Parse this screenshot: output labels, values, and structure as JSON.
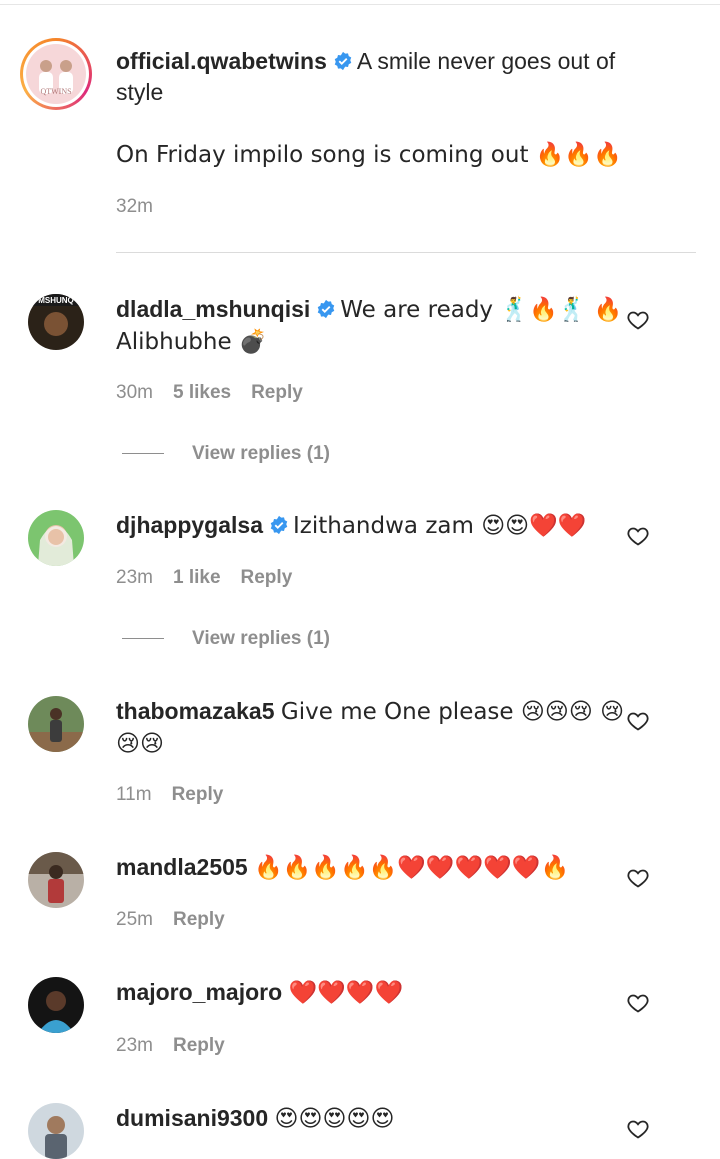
{
  "caption": {
    "username": "official.qwabetwins",
    "avatar_text": "QTWINS",
    "text": "A smile never goes out of style",
    "text2": "On Friday impilo song is coming out 🔥🔥🔥",
    "time": "32m"
  },
  "comments": [
    {
      "username": "dladla_mshunqisi",
      "avatar_text": "MSHUNQ",
      "text": "We are ready 🕺🔥🕺 🔥 Alibhubhe 💣",
      "time": "30m",
      "likes": "5 likes",
      "reply": "Reply",
      "view_replies": "View replies (1)"
    },
    {
      "username": "djhappygalsa",
      "text": "Izithandwa zam 😍😍❤️❤️",
      "time": "23m",
      "likes": "1 like",
      "reply": "Reply",
      "view_replies": "View replies (1)"
    },
    {
      "username": "thabomazaka5",
      "text": "Give me One please 😢😢😢 😢😢😢",
      "time": "11m",
      "reply": "Reply"
    },
    {
      "username": "mandla2505",
      "text": "🔥🔥🔥🔥🔥❤️❤️❤️❤️❤️🔥",
      "time": "25m",
      "reply": "Reply"
    },
    {
      "username": "majoro_majoro",
      "text": "❤️❤️❤️❤️",
      "time": "23m",
      "reply": "Reply"
    },
    {
      "username": "dumisani9300",
      "text": "😍😍😍😍😍"
    }
  ],
  "icons": {
    "verified": "verified-badge-icon",
    "like": "heart-outline-icon"
  },
  "colors": {
    "verified": "#3897f0",
    "muted": "#8e8e8e",
    "text": "#262626"
  }
}
